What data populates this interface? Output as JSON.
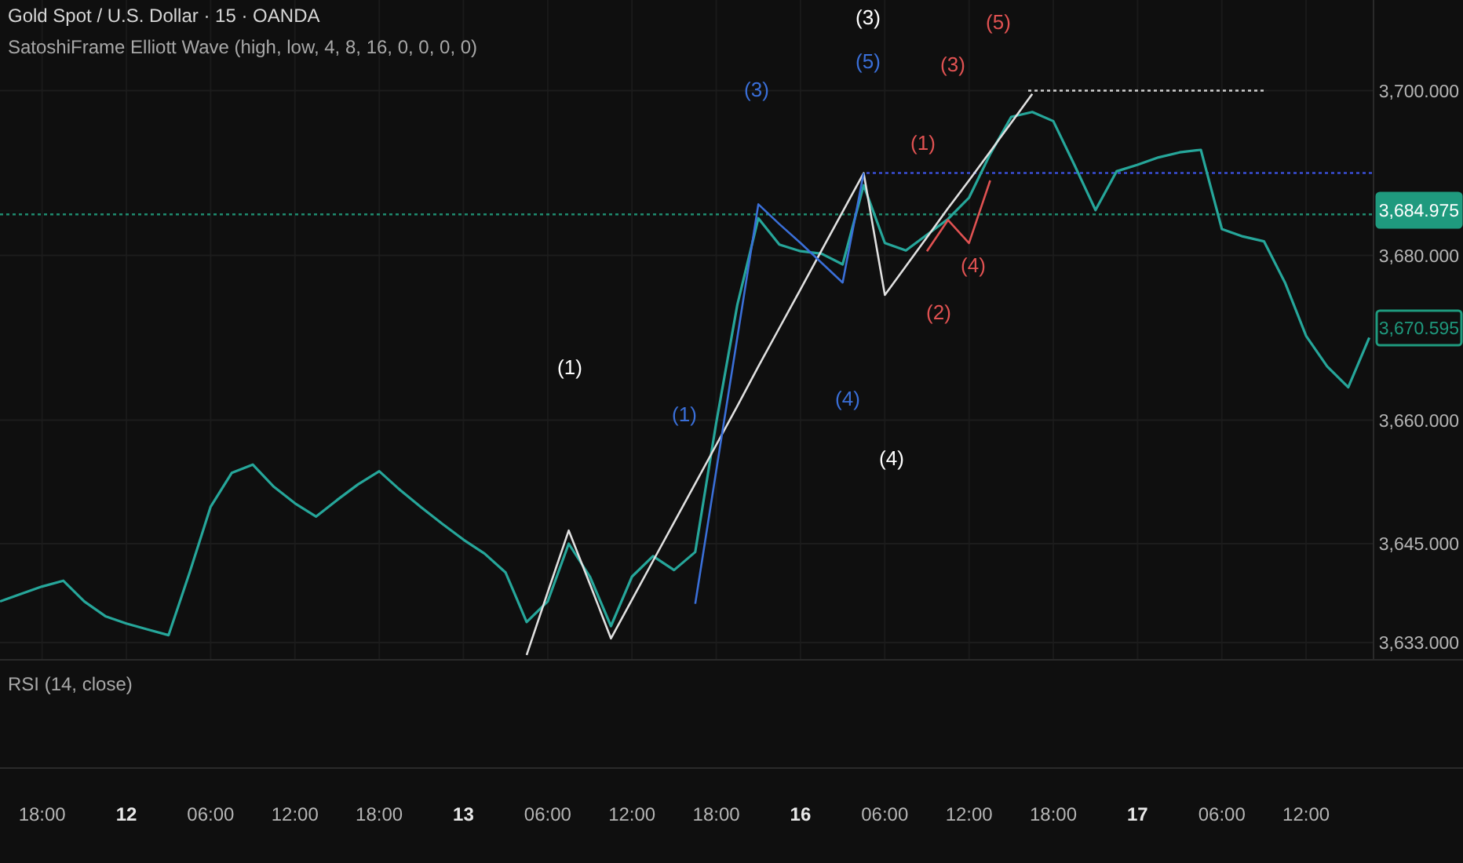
{
  "legend": {
    "symbol": "Gold Spot / U.S. Dollar · 15 · OANDA",
    "indicator": "SatoshiFrame Elliott Wave (high, low, 4, 8, 16, 0, 0, 0, 0)"
  },
  "chart_data": {
    "type": "line",
    "ylim": [
      3631,
      3711
    ],
    "grid": true,
    "ref_lines": [
      {
        "axis": "y",
        "value": 3700,
        "color": "#d0d0d0"
      },
      {
        "axis": "y",
        "value": 3690,
        "color": "#3a4fd8"
      },
      {
        "axis": "y",
        "value": 3684.975,
        "color": "#1f8a6e"
      }
    ],
    "categories": [
      null,
      null,
      "18:00",
      null,
      null,
      null,
      "**12**",
      null,
      null,
      null,
      "06:00",
      null,
      null,
      null,
      "12:00",
      null,
      null,
      null,
      "18:00",
      null,
      null,
      null,
      "**13**",
      null,
      null,
      null,
      "06:00",
      null,
      null,
      null,
      "12:00",
      null,
      null,
      null,
      "18:00",
      null,
      null,
      null,
      "**16**",
      null,
      null,
      null,
      "06:00",
      null,
      null,
      null,
      "12:00",
      null,
      null,
      null,
      "18:00",
      null,
      null,
      null,
      "**17**",
      null,
      null,
      null,
      "06:00",
      null,
      null,
      null,
      "12:00",
      null,
      null,
      null
    ],
    "series": [
      {
        "color": "#26a69a",
        "values": [
          3638.0,
          3638.9,
          3639.8,
          3640.5,
          3638.0,
          3636.2,
          3635.3,
          3634.6,
          3633.9,
          3641.5,
          3649.5,
          3653.6,
          3654.6,
          3651.9,
          3649.9,
          3648.3,
          3650.3,
          3652.2,
          3653.8,
          3651.5,
          3649.4,
          3647.4,
          3645.5,
          3643.8,
          3641.5,
          3635.5,
          3638.0,
          3645.0,
          3641.0,
          3635.0,
          3641.0,
          3643.5,
          3641.8,
          3644.0,
          3659.7,
          3674.0,
          3684.5,
          3681.3,
          3680.5,
          3680.2,
          3678.9,
          3688.5,
          3681.5,
          3680.6,
          3682.5,
          3684.4,
          3687.0,
          3692.3,
          3696.8,
          3697.4,
          3696.3,
          3691.0,
          3685.5,
          3690.2,
          3691.0,
          3691.9,
          3692.5,
          3692.8,
          3683.2,
          3682.3,
          3681.7,
          3676.7,
          3670.2,
          3666.5,
          3664.0,
          3670.0
        ]
      },
      {
        "color": "#e0e0e0",
        "values": [
          null,
          null,
          null,
          null,
          null,
          null,
          null,
          null,
          null,
          null,
          null,
          null,
          null,
          null,
          null,
          null,
          null,
          null,
          null,
          null,
          null,
          null,
          null,
          null,
          null,
          3631.5,
          3639.1,
          3646.6,
          3640.1,
          3633.5,
          3638.2,
          3642.9,
          3647.6,
          3652.3,
          3657.0,
          3661.7,
          3666.5,
          3671.2,
          3675.9,
          3680.6,
          3685.3,
          3690.0,
          3675.2,
          3678.7,
          3682.2,
          3685.7,
          3689.1,
          3692.6,
          3696.1,
          3699.6,
          null,
          null,
          null,
          null,
          null,
          null,
          null,
          null,
          null,
          null,
          null,
          null,
          null,
          null,
          null,
          null
        ]
      },
      {
        "color": "#3a6fd8",
        "values": [
          null,
          null,
          null,
          null,
          null,
          null,
          null,
          null,
          null,
          null,
          null,
          null,
          null,
          null,
          null,
          null,
          null,
          null,
          null,
          null,
          null,
          null,
          null,
          null,
          null,
          null,
          null,
          null,
          null,
          null,
          null,
          null,
          null,
          3637.7,
          3653.9,
          3670.0,
          3686.2,
          3683.8,
          3681.5,
          3679.1,
          3676.7,
          3690.0,
          null,
          null,
          null,
          null,
          null,
          null,
          null,
          null,
          null,
          null,
          null,
          null,
          null,
          null,
          null,
          null,
          null,
          null,
          null,
          null,
          null,
          null,
          null,
          null
        ]
      },
      {
        "color": "#e05252",
        "values": [
          null,
          null,
          null,
          null,
          null,
          null,
          null,
          null,
          null,
          null,
          null,
          null,
          null,
          null,
          null,
          null,
          null,
          null,
          null,
          null,
          null,
          null,
          null,
          null,
          null,
          null,
          null,
          null,
          null,
          null,
          null,
          null,
          null,
          null,
          null,
          null,
          null,
          null,
          null,
          null,
          null,
          null,
          null,
          null,
          3680.5,
          3684.3,
          3681.5,
          3689.1,
          null,
          null,
          null,
          null,
          null,
          null,
          null,
          null,
          null,
          null,
          null,
          null,
          null,
          null,
          null,
          null,
          null,
          null
        ]
      }
    ],
    "yticks": [
      {
        "value": 3700,
        "label": "3,700.000"
      },
      {
        "value": 3680,
        "label": "3,680.000"
      },
      {
        "value": 3660,
        "label": "3,660.000"
      },
      {
        "value": 3645,
        "label": "3,645.000"
      },
      {
        "value": 3633,
        "label": "3,633.000"
      }
    ]
  },
  "wave_labels": [
    {
      "text": "(3)",
      "color": "#ffffff"
    },
    {
      "text": "(5)",
      "color": "#3a6fd8"
    },
    {
      "text": "(3)",
      "color": "#3a6fd8"
    },
    {
      "text": "(5)",
      "color": "#e05252"
    },
    {
      "text": "(3)",
      "color": "#e05252"
    },
    {
      "text": "(1)",
      "color": "#e05252"
    },
    {
      "text": "(4)",
      "color": "#e05252"
    },
    {
      "text": "(2)",
      "color": "#e05252"
    },
    {
      "text": "(1)",
      "color": "#ffffff"
    },
    {
      "text": "(1)",
      "color": "#3a6fd8"
    },
    {
      "text": "(4)",
      "color": "#3a6fd8"
    },
    {
      "text": "(4)",
      "color": "#ffffff"
    }
  ],
  "price_badges": [
    {
      "text": "3,684.975",
      "filled": true
    },
    {
      "text": "3,670.595",
      "filled": false
    }
  ],
  "rsi_pane": {
    "label": "RSI (14, close)"
  }
}
